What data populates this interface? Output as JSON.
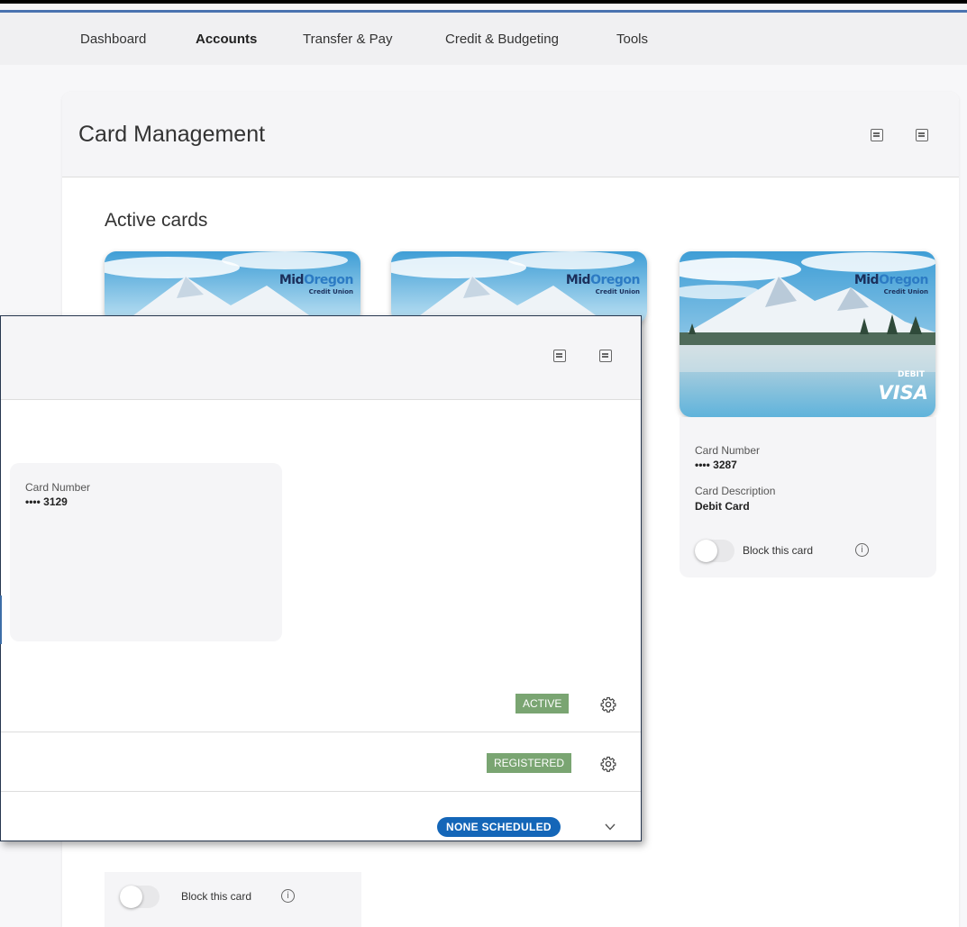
{
  "nav": {
    "items": [
      {
        "label": "Dashboard",
        "active": false
      },
      {
        "label": "Accounts",
        "active": true
      },
      {
        "label": "Transfer & Pay",
        "active": false
      },
      {
        "label": "Credit & Budgeting",
        "active": false
      },
      {
        "label": "Tools",
        "active": false
      }
    ]
  },
  "panel": {
    "title": "Card Management",
    "section_title": "Active cards"
  },
  "card_brand": {
    "logo_mid": "Mid",
    "logo_oregon": "Oregon",
    "logo_sub": "Credit Union",
    "debit": "DEBIT",
    "network": "VISA"
  },
  "cards": [
    {
      "number_label": "Card Number",
      "number": "•••• 3287",
      "description_label": "Card Description",
      "description": "Debit Card",
      "block_label": "Block this card",
      "blocked": false
    }
  ],
  "overlay": {
    "card_number_label": "Card Number",
    "card_number": "•••• 3129",
    "status_badge": "ACTIVE",
    "registration_badge": "REGISTERED",
    "schedule_pill": "NONE SCHEDULED",
    "block_label": "Block this card",
    "info_symbol": "i"
  },
  "colors": {
    "accent": "#4a73b0",
    "badge_green": "#7aa572",
    "pill_blue": "#1466b8"
  }
}
